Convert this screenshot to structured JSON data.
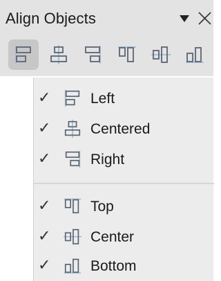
{
  "panel": {
    "title": "Align Objects",
    "dropdown_icon": "triangle-down-icon",
    "close_icon": "close-icon"
  },
  "toolbar": {
    "buttons": [
      {
        "icon": "align-left-icon",
        "active": true
      },
      {
        "icon": "align-centered-icon",
        "active": false
      },
      {
        "icon": "align-right-icon",
        "active": false
      },
      {
        "icon": "align-top-icon",
        "active": false
      },
      {
        "icon": "align-center-icon",
        "active": false
      },
      {
        "icon": "align-bottom-icon",
        "active": false
      }
    ]
  },
  "menu": {
    "check_glyph": "✓",
    "horizontal_items": [
      {
        "label": "Left",
        "checked": true,
        "icon": "align-left-icon"
      },
      {
        "label": "Centered",
        "checked": true,
        "icon": "align-centered-icon"
      },
      {
        "label": "Right",
        "checked": true,
        "icon": "align-right-icon"
      }
    ],
    "vertical_items": [
      {
        "label": "Top",
        "checked": true,
        "icon": "align-top-icon"
      },
      {
        "label": "Center",
        "checked": true,
        "icon": "align-center-icon"
      },
      {
        "label": "Bottom",
        "checked": true,
        "icon": "align-bottom-icon"
      }
    ]
  },
  "colors": {
    "toolbar_bg": "#e3e3e3",
    "menu_bg": "#ececec",
    "active_button_bg": "#c7c7c7",
    "icon_stroke": "#5a6473",
    "icon_guide": "#a9bfd8"
  }
}
